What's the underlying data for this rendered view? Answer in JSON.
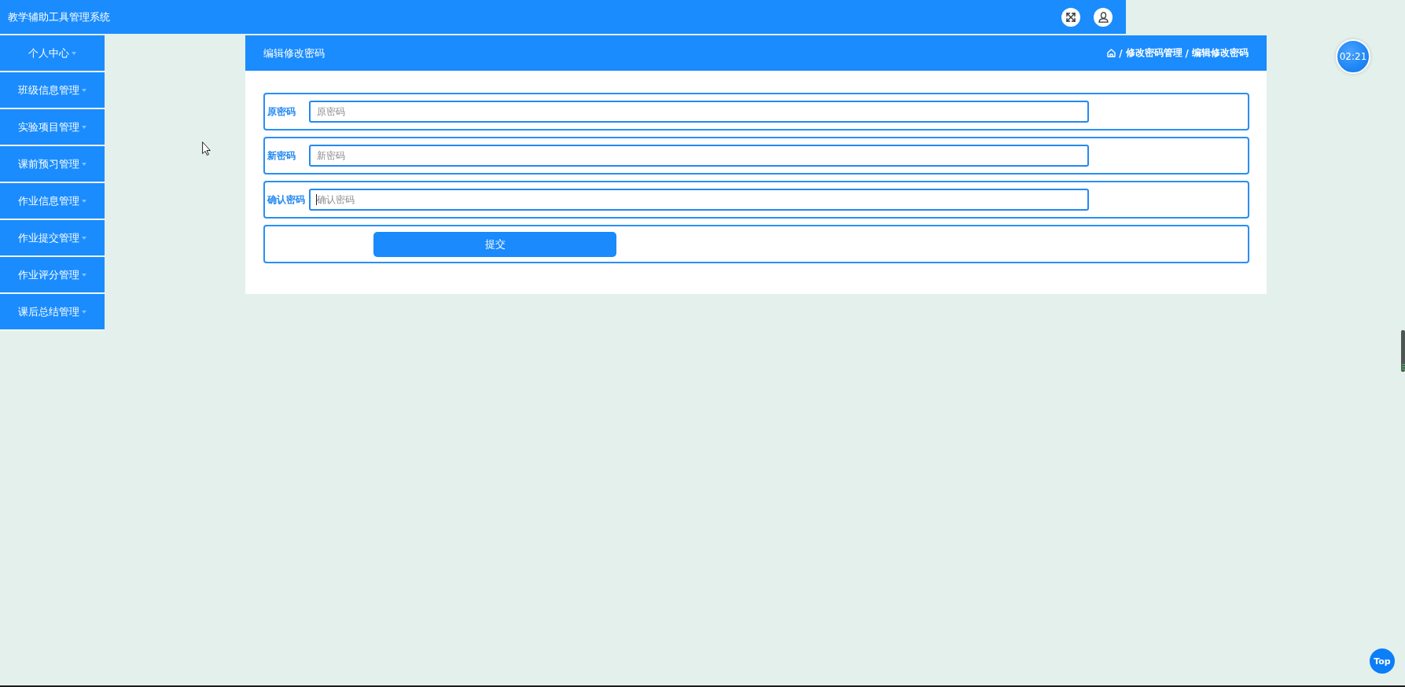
{
  "header": {
    "title": "教学辅助工具管理系统"
  },
  "sidebar": {
    "items": [
      {
        "label": "个人中心"
      },
      {
        "label": "班级信息管理"
      },
      {
        "label": "实验项目管理"
      },
      {
        "label": "课前预习管理"
      },
      {
        "label": "作业信息管理"
      },
      {
        "label": "作业提交管理"
      },
      {
        "label": "作业评分管理"
      },
      {
        "label": "课后总结管理"
      }
    ]
  },
  "panel": {
    "title": "编辑修改密码",
    "breadcrumb": [
      {
        "separator": "/",
        "label": "修改密码管理"
      },
      {
        "separator": "/",
        "label": "编辑修改密码"
      }
    ]
  },
  "form": {
    "fields": [
      {
        "label": "原密码",
        "placeholder": "原密码",
        "focused": false
      },
      {
        "label": "新密码",
        "placeholder": "新密码",
        "focused": false
      },
      {
        "label": "确认密码",
        "placeholder": "确认密码",
        "focused": true
      }
    ],
    "submit": "提交"
  },
  "clock": {
    "time": "02:21"
  },
  "back_to_top": {
    "label": "Top"
  }
}
